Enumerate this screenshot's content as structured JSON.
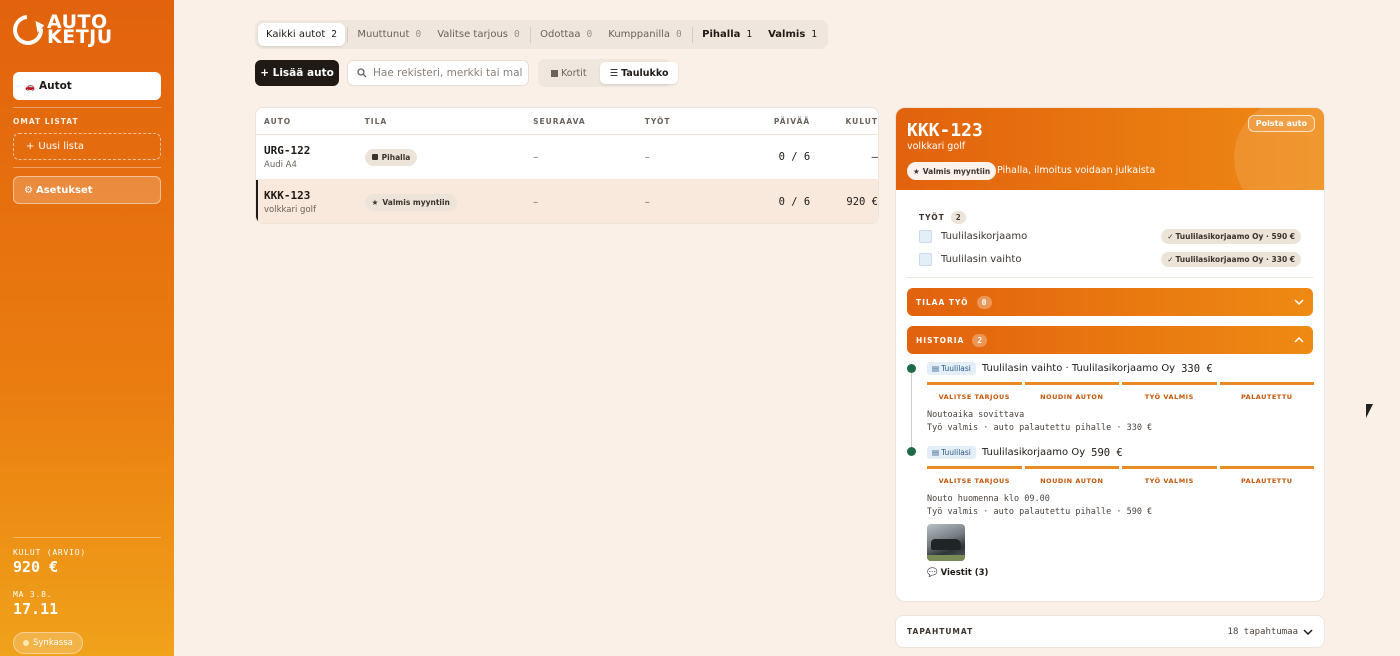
{
  "sidebar": {
    "logo_line1": "AUTO",
    "logo_line2": "KETJU",
    "nav_autot": "Autot",
    "nav_autot_icon": "🚗",
    "section_label": "OMAT LISTAT",
    "new_list": "Uusi lista",
    "settings": "Asetukset",
    "costs_label": "KULUT (ARVIO)",
    "costs_value": "920 €",
    "date_label": "MA 3.8.",
    "time_value": "17.11",
    "sync_label": "Synkassa"
  },
  "filters": [
    {
      "label": "Kaikki autot",
      "count": "2"
    },
    {
      "label": "Muuttunut",
      "count": "0"
    },
    {
      "label": "Valitse tarjous",
      "count": "0"
    },
    {
      "label": "Odottaa",
      "count": "0"
    },
    {
      "label": "Kumppanilla",
      "count": "0"
    },
    {
      "label": "Pihalla",
      "count": "1"
    },
    {
      "label": "Valmis",
      "count": "1"
    }
  ],
  "toolbar": {
    "add_car": "+ Lisää auto",
    "search_placeholder": "Hae rekisteri, merkki tai malli",
    "view_cards": "Kortit",
    "view_table": "Taulukko"
  },
  "table": {
    "headers": [
      "AUTO",
      "TILA",
      "SEURAAVA",
      "TYÖT",
      "PÄIVÄÄ",
      "KULUT"
    ],
    "rows": [
      {
        "plate": "URG-122",
        "model": "Audi A4",
        "status": "Pihalla",
        "next": "–",
        "jobs": "–",
        "days": "0 / 6",
        "costs": "—"
      },
      {
        "plate": "KKK-123",
        "model": "volkkari golf",
        "status": "Valmis myyntiin",
        "next": "–",
        "jobs": "–",
        "days": "0 / 6",
        "costs": "920 €"
      }
    ]
  },
  "detail": {
    "plate": "KKK-123",
    "model": "volkkari golf",
    "badge": "Valmis myyntiin",
    "status_text": "Pihalla, ilmoitus voidaan julkaista",
    "delete": "Poista auto",
    "jobs_label": "TYÖT",
    "jobs_count": "2",
    "jobs": [
      {
        "name": "Tuulilasikorjaamo",
        "chip": "Tuulilasikorjaamo Oy · 590 €"
      },
      {
        "name": "Tuulilasin vaihto",
        "chip": "Tuulilasikorjaamo Oy · 330 €"
      }
    ],
    "order_label": "TILAA TYÖ",
    "order_count": "0",
    "history_label": "HISTORIA",
    "history_count": "2",
    "history": [
      {
        "tag": "Tuulilasi",
        "title": "Tuulilasin vaihto · Tuulilasikorjaamo Oy",
        "price": "330 €",
        "steps": [
          "VALITSE TARJOUS",
          "NOUDIN AUTON",
          "TYÖ VALMIS",
          "PALAUTETTU"
        ],
        "note1": "Noutoaika sovittava",
        "note2": "Työ valmis · auto palautettu pihalle · 330 €"
      },
      {
        "tag": "Tuulilasi",
        "title": "Tuulilasikorjaamo Oy",
        "price": "590 €",
        "steps": [
          "VALITSE TARJOUS",
          "NOUDIN AUTON",
          "TYÖ VALMIS",
          "PALAUTETTU"
        ],
        "note1": "Nouto huomenna klo 09.00",
        "note2": "Työ valmis · auto palautettu pihalle · 590 €"
      }
    ],
    "messages": "Viestit (3)"
  },
  "events": {
    "label": "TAPAHTUMAT",
    "count": "18 tapahtumaa"
  },
  "colors": {
    "brand_orange": "#e2620d",
    "brand_orange_light": "#ee8a13",
    "status_green": "#1f6b45",
    "background": "#fbf0e7"
  }
}
